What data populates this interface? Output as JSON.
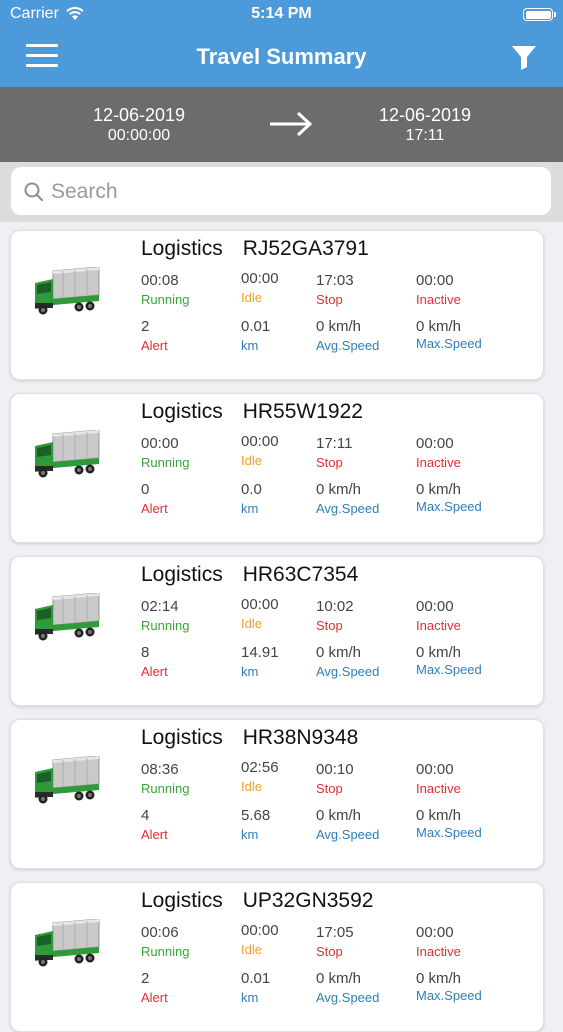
{
  "status_bar": {
    "carrier": "Carrier",
    "time": "5:14 PM"
  },
  "header": {
    "title": "Travel Summary"
  },
  "date_range": {
    "from_date": "12-06-2019",
    "from_time": "00:00:00",
    "to_date": "12-06-2019",
    "to_time": "17:11"
  },
  "search": {
    "placeholder": "Search"
  },
  "labels": {
    "running": "Running",
    "idle": "Idle",
    "stop": "Stop",
    "inactive": "Inactive",
    "alert": "Alert",
    "km": "km",
    "avg_speed": "Avg.Speed",
    "max_speed": "Max.Speed"
  },
  "vehicles": [
    {
      "group": "Logistics",
      "plate": "RJ52GA3791",
      "running": "00:08",
      "idle": "00:00",
      "stop": "17:03",
      "inactive": "00:00",
      "alert": "2",
      "km": "0.01",
      "avg_speed": "0 km/h",
      "max_speed": "0 km/h"
    },
    {
      "group": "Logistics",
      "plate": "HR55W1922",
      "running": "00:00",
      "idle": "00:00",
      "stop": "17:11",
      "inactive": "00:00",
      "alert": "0",
      "km": "0.0",
      "avg_speed": "0 km/h",
      "max_speed": "0 km/h"
    },
    {
      "group": "Logistics",
      "plate": "HR63C7354",
      "running": "02:14",
      "idle": "00:00",
      "stop": "10:02",
      "inactive": "00:00",
      "alert": "8",
      "km": "14.91",
      "avg_speed": "0 km/h",
      "max_speed": "0 km/h"
    },
    {
      "group": "Logistics",
      "plate": "HR38N9348",
      "running": "08:36",
      "idle": "02:56",
      "stop": "00:10",
      "inactive": "00:00",
      "alert": "4",
      "km": "5.68",
      "avg_speed": "0 km/h",
      "max_speed": "0 km/h"
    },
    {
      "group": "Logistics",
      "plate": "UP32GN3592",
      "running": "00:06",
      "idle": "00:00",
      "stop": "17:05",
      "inactive": "00:00",
      "alert": "2",
      "km": "0.01",
      "avg_speed": "0 km/h",
      "max_speed": "0 km/h"
    }
  ],
  "colors": {
    "header": "#4c9ad9",
    "date_bar": "#6c6c6c",
    "running": "#3aa53a",
    "idle": "#f0a030",
    "stop": "#e03030",
    "label_blue": "#2f7fb8",
    "truck_cab": "#2e9a3a"
  },
  "icons": [
    "wifi-icon",
    "battery-icon",
    "menu-icon",
    "filter-icon",
    "arrow-right-icon",
    "search-icon",
    "truck-icon"
  ]
}
